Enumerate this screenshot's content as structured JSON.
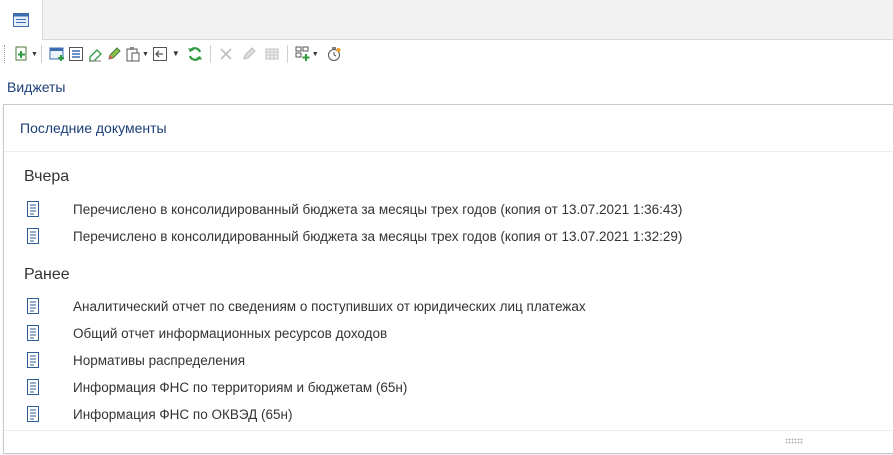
{
  "tabs": [
    {
      "icon": "window-icon"
    }
  ],
  "toolbar": {
    "buttons": [
      {
        "icon": "add-green-icon",
        "dropdown": true
      },
      {
        "icon": "add-window-icon",
        "dropdown": false
      },
      {
        "icon": "list-icon",
        "dropdown": false
      },
      {
        "icon": "eraser-icon",
        "dropdown": false
      },
      {
        "icon": "pencil-edit-icon",
        "dropdown": false
      },
      {
        "icon": "clipboard-icon",
        "dropdown": true
      },
      {
        "icon": "arrow-left-box-icon",
        "dropdown": false
      },
      {
        "icon": "dropdown-arrow-icon",
        "dropdown": true
      },
      {
        "icon": "refresh-icon",
        "dropdown": false
      },
      {
        "icon": "close-x-icon",
        "dropdown": false,
        "disabled": true
      },
      {
        "icon": "pencil-disabled-icon",
        "dropdown": false,
        "disabled": true
      },
      {
        "icon": "grid-disabled-icon",
        "dropdown": false,
        "disabled": true
      },
      {
        "icon": "widget-add-icon",
        "dropdown": true
      },
      {
        "icon": "settings-timer-icon",
        "dropdown": false
      }
    ]
  },
  "section_title": "Виджеты",
  "widget": {
    "title": "Последние документы",
    "groups": [
      {
        "title": "Вчера",
        "items": [
          "Перечислено в консолидированный бюджета за месяцы трех годов (копия от 13.07.2021 1:36:43)",
          "Перечислено в консолидированный бюджета за месяцы трех годов (копия от 13.07.2021 1:32:29)"
        ]
      },
      {
        "title": "Ранее",
        "items": [
          "Аналитический отчет по сведениям о поступивших от юридических лиц платежах",
          "Общий отчет информационных ресурсов доходов",
          "Нормативы распределения",
          "Информация ФНС по территориям и бюджетам (65н)",
          "Информация ФНС по ОКВЭД (65н)"
        ]
      }
    ]
  },
  "colors": {
    "accent": "#1c3f78",
    "doc_icon": "#2e5c9a",
    "green": "#2e9b3e"
  }
}
